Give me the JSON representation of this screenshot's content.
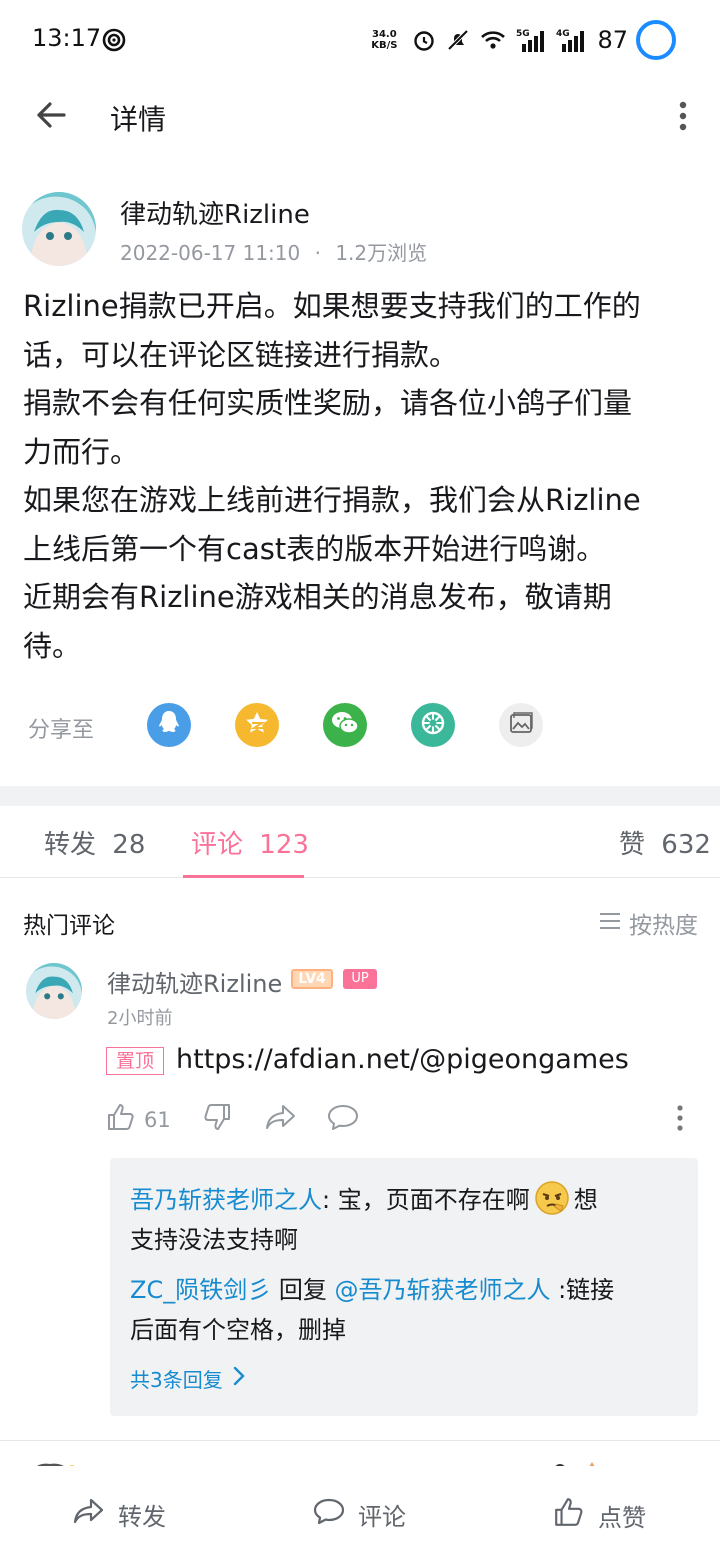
{
  "status": {
    "time": "13:17",
    "net_speed_value": "34.0",
    "net_speed_unit": "KB/S",
    "sim1": "5G",
    "sim2": "4G",
    "battery": "87"
  },
  "app_bar": {
    "title": "详情"
  },
  "post": {
    "author": "律动轨迹Rizline",
    "date": "2022-06-17 11:10",
    "views": "1.2万浏览",
    "meta_sep": "·",
    "lines": [
      "Rizline捐款已开启。如果想要支持我们的工作的",
      "话，可以在评论区链接进行捐款。",
      "捐款不会有任何实质性奖励，请各位小鸽子们量",
      "力而行。",
      "如果您在游戏上线前进行捐款，我们会从Rizline",
      "上线后第一个有cast表的版本开始进行鸣谢。",
      "近期会有Rizline游戏相关的消息发布，敬请期",
      "待。"
    ]
  },
  "share": {
    "label": "分享至",
    "targets": [
      "qq-icon",
      "qzone-icon",
      "wechat-icon",
      "moments-icon",
      "image-icon"
    ]
  },
  "tabs": {
    "repost_label": "转发",
    "repost_count": "28",
    "comment_label": "评论",
    "comment_count": "123",
    "like_label": "赞",
    "like_count": "632"
  },
  "comments": {
    "section_title": "热门评论",
    "sort_label": "按热度",
    "top": {
      "user": "律动轨迹Rizline",
      "level_badge": "LV4",
      "up_badge": "UP",
      "time": "2小时前",
      "pin_tag": "置顶",
      "text": "https://afdian.net/@pigeongames",
      "likes": "61"
    },
    "replies": [
      {
        "user": "吾乃斩获老师之人",
        "colon": ": ",
        "text_a": "宝，页面不存在啊",
        "text_b": "想",
        "text_c": "支持没法支持啊"
      },
      {
        "user": "ZC_陨铁剑彡",
        "reply_word": " 回复 ",
        "mention": "@吾乃斩获老师之人",
        "text_a": " :链接",
        "text_b": "后面有个空格，删掉"
      }
    ],
    "more_replies": "共3条回复"
  },
  "bottom_bar": {
    "repost": "转发",
    "comment": "评论",
    "like": "点赞"
  },
  "colors": {
    "accent": "#fb7299",
    "link": "#178bcf",
    "muted": "#9499a0"
  }
}
